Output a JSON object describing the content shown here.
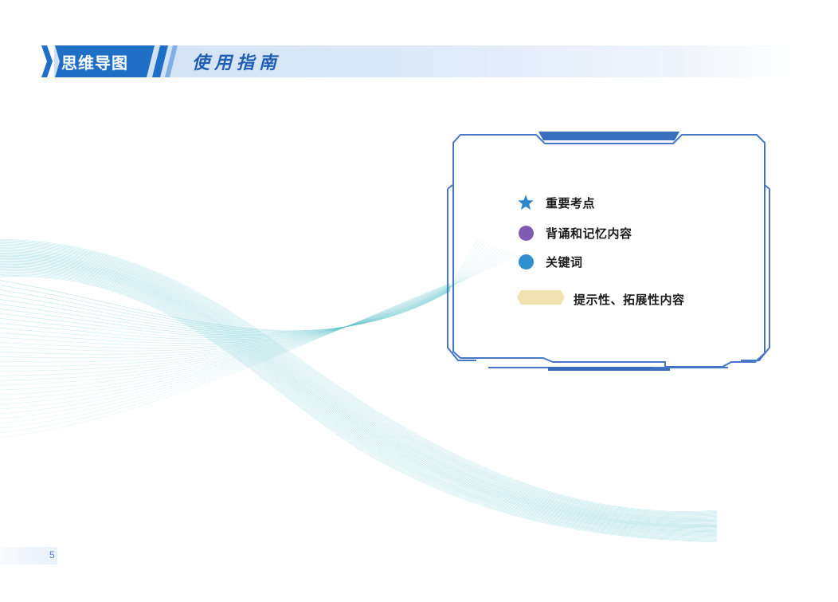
{
  "header": {
    "title": "思维导图",
    "subtitle": "使用指南",
    "colors": {
      "tab": "#1f6fc6",
      "subtitle": "#1f5fb3",
      "bar": "#d6e5f7"
    }
  },
  "legend": {
    "items": [
      {
        "icon": "star-icon",
        "label": "重要考点",
        "color": "#2e86cc"
      },
      {
        "icon": "purple-dot-icon",
        "label": "背诵和记忆内容",
        "color": "#7f5bb4"
      },
      {
        "icon": "blue-dot-icon",
        "label": "关键词",
        "color": "#2f8fcf"
      },
      {
        "icon": "hexagon-tag-icon",
        "label": "提示性、拓展性内容",
        "color": "#f2e2b1"
      }
    ],
    "frame_color": "#3f74c4"
  },
  "decor": {
    "wave_color": "#56c1c9"
  },
  "footer": {
    "page_number": "5"
  }
}
